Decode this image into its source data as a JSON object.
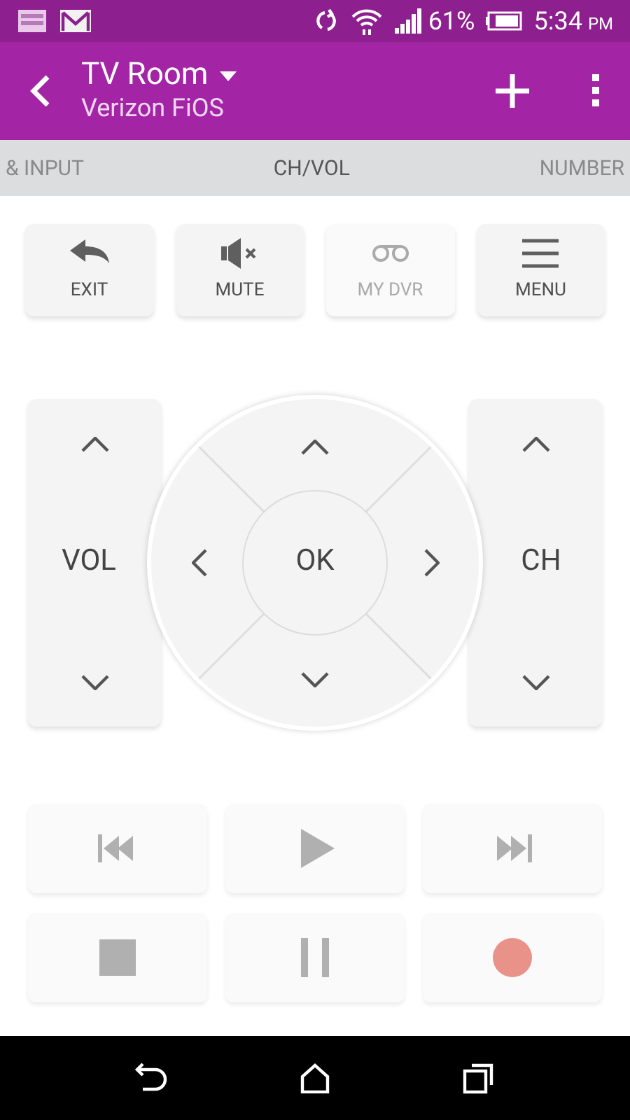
{
  "status_bar": {
    "battery": "61%",
    "time": "5:34",
    "ampm": "PM"
  },
  "header": {
    "title": "TV Room",
    "subtitle": "Verizon FiOS"
  },
  "tabs": [
    {
      "label": "& INPUT",
      "selected": false
    },
    {
      "label": "CH/VOL",
      "selected": true
    },
    {
      "label": "NUMBER",
      "selected": false
    }
  ],
  "quick_buttons": [
    {
      "kind": "exit",
      "label": "EXIT",
      "disabled": false
    },
    {
      "kind": "mute",
      "label": "MUTE",
      "disabled": false
    },
    {
      "kind": "dvr",
      "label": "MY DVR",
      "disabled": true
    },
    {
      "kind": "menu",
      "label": "MENU",
      "disabled": false
    }
  ],
  "dpad": {
    "volume_label": "VOL",
    "ok_label": "OK",
    "channel_label": "CH"
  },
  "media_buttons": [
    {
      "kind": "previous"
    },
    {
      "kind": "play"
    },
    {
      "kind": "next"
    },
    {
      "kind": "stop"
    },
    {
      "kind": "pause"
    },
    {
      "kind": "record"
    }
  ]
}
